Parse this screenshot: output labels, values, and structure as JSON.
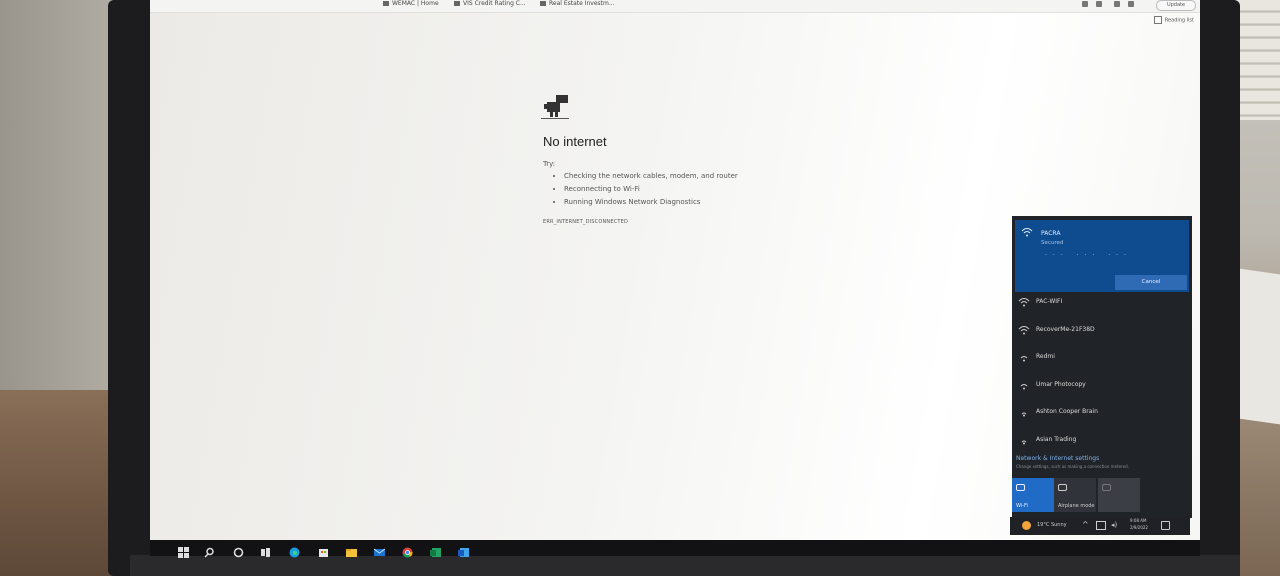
{
  "browser": {
    "bookmarks": [
      {
        "label": "WEMAC | Home"
      },
      {
        "label": "VIS Credit Rating C..."
      },
      {
        "label": "Real Estate Investm..."
      }
    ],
    "update_label": "Update",
    "reading_list_label": "Reading list"
  },
  "error_page": {
    "title": "No internet",
    "try_label": "Try:",
    "suggestions": [
      "Checking the network cables, modem, and router",
      "Reconnecting to Wi-Fi",
      "Running Windows Network Diagnostics"
    ],
    "error_code": "ERR_INTERNET_DISCONNECTED"
  },
  "wifi_flyout": {
    "connecting": {
      "name": "PACRA",
      "status": "Secured",
      "dots": "... ... ...",
      "cancel_label": "Cancel"
    },
    "networks": [
      {
        "name": "PAC-WIFI"
      },
      {
        "name": "RecoverMe-21F38D"
      },
      {
        "name": "Redmi"
      },
      {
        "name": "Umar Photocopy"
      },
      {
        "name": "Ashton Cooper Brain"
      },
      {
        "name": "Asian Trading"
      }
    ],
    "settings_link": "Network & Internet settings",
    "settings_sub": "Change settings, such as making a connection metered.",
    "quick_actions": [
      {
        "label": "Wi-Fi",
        "state": "on"
      },
      {
        "label": "Airplane mode",
        "state": "off"
      },
      {
        "label": "",
        "state": "disabled"
      }
    ]
  },
  "taskbar": {
    "weather": "19°C  Sunny",
    "time": "9:08 AM",
    "date": "2/9/2022",
    "apps": [
      "start-icon",
      "search-icon",
      "cortana-icon",
      "task-view-icon",
      "edge-icon",
      "store-icon",
      "file-explorer-icon",
      "mail-icon",
      "chrome-icon",
      "excel-icon",
      "word-icon"
    ]
  },
  "colors": {
    "flyout_bg": "#202327",
    "connecting_bg": "#0f4c8f",
    "accent": "#1f6bc6"
  }
}
